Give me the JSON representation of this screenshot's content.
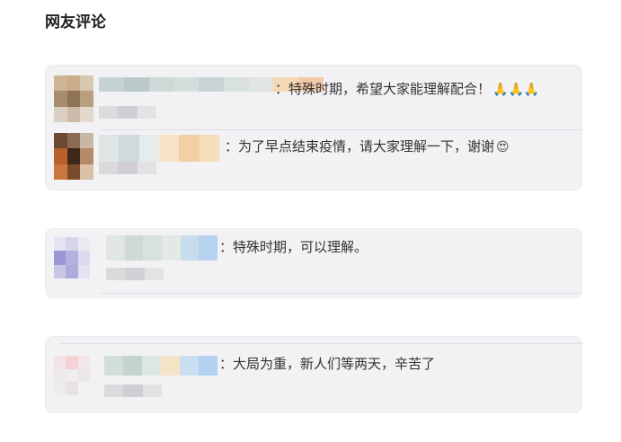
{
  "section": {
    "title": "网友评论"
  },
  "comments": [
    {
      "text": "：特殊时期，希望大家能理解配合！",
      "emoji": "🙏🙏🙏"
    },
    {
      "text": "：为了早点结束疫情，请大家理解一下，谢谢",
      "emoji": "😍"
    },
    {
      "text": "：特殊时期，可以理解。"
    },
    {
      "text": "：大局为重，新人们等两天，辛苦了"
    }
  ],
  "colors": {
    "card_bg": "#f2f2f5",
    "text": "#333333"
  }
}
